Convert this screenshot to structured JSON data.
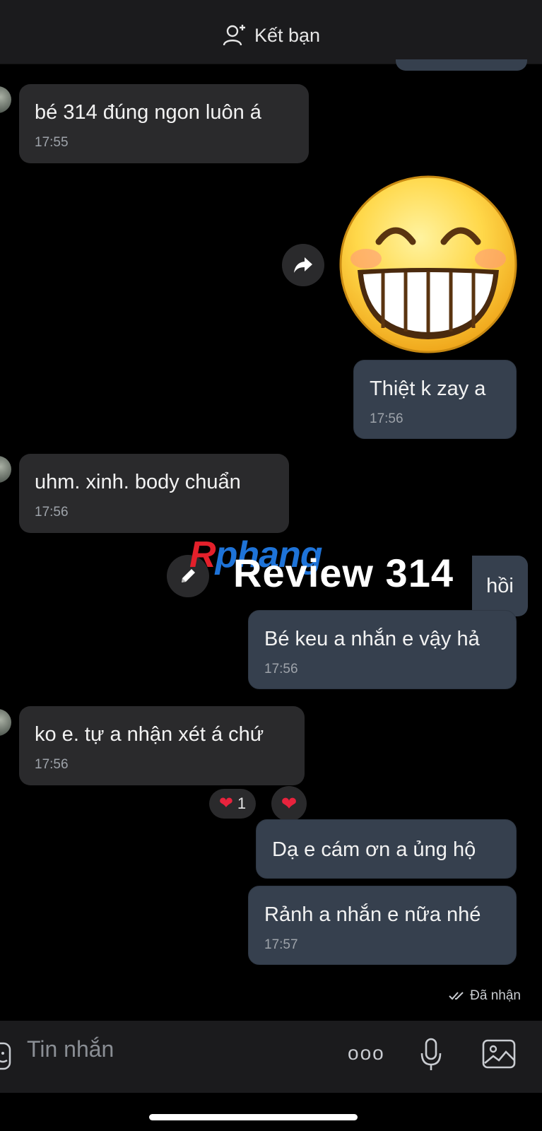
{
  "header": {
    "add_friend_label": "Kết bạn"
  },
  "messages": [
    {
      "text": "bé 314 đúng ngon luôn á",
      "time": "17:55"
    },
    {
      "text": "Thiệt k zay a",
      "time": "17:56"
    },
    {
      "text": "uhm. xinh. body chuẩn",
      "time": "17:56"
    },
    {
      "text": "hồi"
    },
    {
      "text": "Bé keu a nhắn e vậy hả",
      "time": "17:56"
    },
    {
      "text": "ko e. tự a nhận xét á chứ",
      "time": "17:56"
    },
    {
      "text": "Dạ e cám ơn a ủng hộ"
    },
    {
      "text": "Rảnh a nhắn e nữa nhé",
      "time": "17:57"
    }
  ],
  "reactions": {
    "heart_count": "1"
  },
  "watermark": {
    "text": "Review 314",
    "logo_r": "R",
    "logo_rest": "phang"
  },
  "status": {
    "delivered": "Đã nhận"
  },
  "composer": {
    "placeholder": "Tin nhắn",
    "more_label": "ooo"
  },
  "colors": {
    "incoming_bubble": "#2a2a2c",
    "outgoing_bubble": "#36404e",
    "heart": "#e8233d",
    "background": "#000000"
  }
}
